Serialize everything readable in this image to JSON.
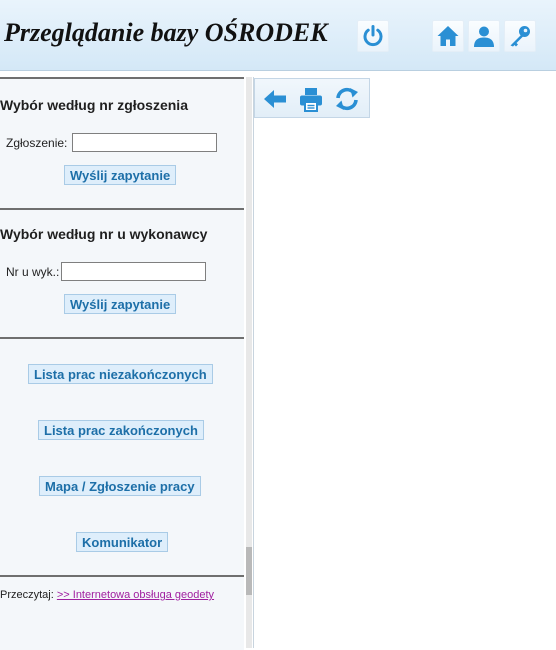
{
  "header": {
    "title": "Przeglądanie bazy OŚRODEK",
    "icons": [
      "power-icon",
      "home-icon",
      "user-icon",
      "key-icon"
    ]
  },
  "left": {
    "section1": {
      "title": "Wybór według nr zgłoszenia",
      "label": "Zgłoszenie:",
      "value": "",
      "button": "Wyślij zapytanie"
    },
    "section2": {
      "title": "Wybór według nr u wykonawcy",
      "label": "Nr u wyk.:",
      "value": "",
      "button": "Wyślij zapytanie"
    },
    "links": {
      "unfinished": "Lista prac niezakończonych",
      "finished": "Lista prac zakończonych",
      "map": "Mapa / Zgłoszenie pracy",
      "messenger": "Komunikator"
    },
    "footer": {
      "prefix": "Przeczytaj:",
      "link": ">> Internetowa obsługa geodety"
    }
  },
  "toolbar": {
    "icons": [
      "back-arrow-icon",
      "print-icon",
      "refresh-icon"
    ]
  },
  "colors": {
    "accent": "#1d6fa8",
    "icon": "#2a8fd4",
    "link": "#a020a0"
  }
}
